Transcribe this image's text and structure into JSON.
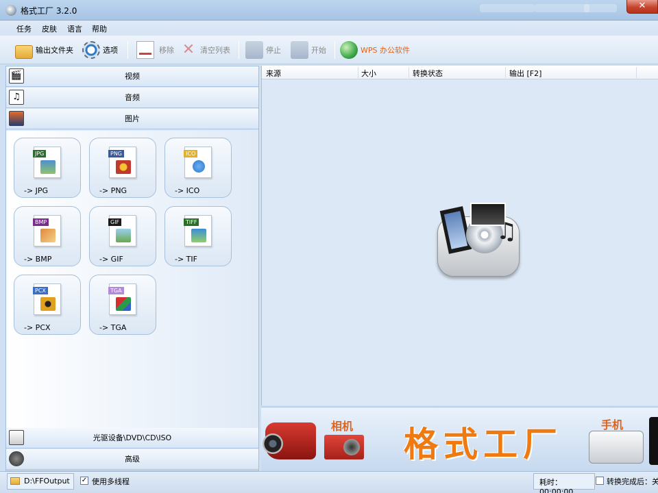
{
  "window": {
    "title": "格式工厂 3.2.0"
  },
  "menu": [
    "任务",
    "皮肤",
    "语言",
    "帮助"
  ],
  "toolbar": {
    "output_folder": "输出文件夹",
    "options": "选项",
    "remove": "移除",
    "clear_list": "清空列表",
    "stop": "停止",
    "start": "开始",
    "wps": "WPS 办公软件"
  },
  "categories": {
    "video": "视频",
    "audio": "音频",
    "image": "图片",
    "dvd": "光驱设备\\DVD\\CD\\ISO",
    "advanced": "高级"
  },
  "formats": [
    {
      "tag": "JPG",
      "label": "-> JPG",
      "tag_color": "#2f6a2f",
      "pic_color": "#4f8fd0"
    },
    {
      "tag": "PNG",
      "label": "-> PNG",
      "tag_color": "#3a5a9a",
      "pic_color": "#c0392b"
    },
    {
      "tag": "ICO",
      "label": "-> ICO",
      "tag_color": "#e3b22b",
      "pic_color": "#2b78d0"
    },
    {
      "tag": "BMP",
      "label": "-> BMP",
      "tag_color": "#7a2c8c",
      "pic_color": "#e08a3a"
    },
    {
      "tag": "GIF",
      "label": "-> GIF",
      "tag_color": "#1a1a1a",
      "pic_color": "#6aa84f"
    },
    {
      "tag": "TIFF",
      "label": "-> TIF",
      "tag_color": "#2a6e2a",
      "pic_color": "#3c8dd8"
    },
    {
      "tag": "PCX",
      "label": "-> PCX",
      "tag_color": "#3a6fc9",
      "pic_color": "#e0a020"
    },
    {
      "tag": "TGA",
      "label": "-> TGA",
      "tag_color": "#b28ad8",
      "pic_color": "#2a9a4a"
    }
  ],
  "table": {
    "columns": [
      "来源",
      "大小",
      "转换状态",
      "输出 [F2]"
    ]
  },
  "banner": {
    "camera": "相机",
    "title": "格式工厂",
    "phone": "手机"
  },
  "status": {
    "output_path": "D:\\FFOutput",
    "multithread": "使用多线程",
    "elapsed": "耗时：00:00:00",
    "after_done": "转换完成后：关"
  }
}
